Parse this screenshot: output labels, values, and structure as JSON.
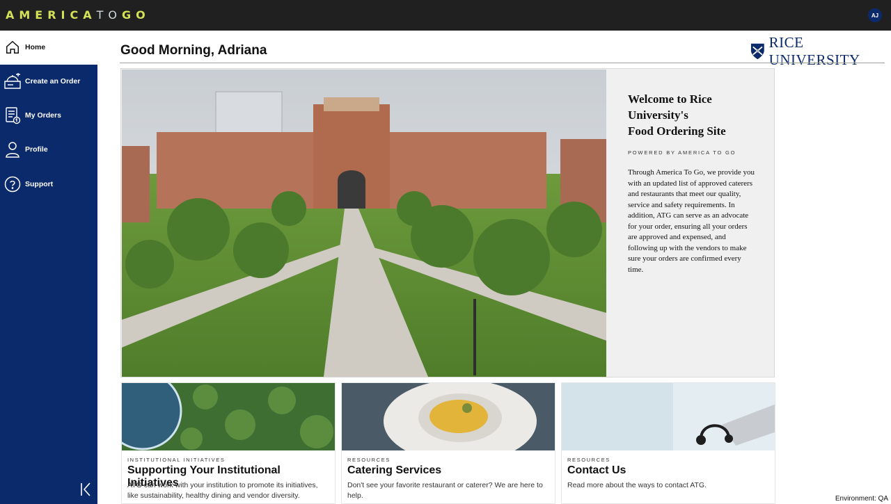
{
  "brand": {
    "part1": "AMERICA",
    "part2": "TO",
    "part3": "GO",
    "accent": "#d4e157"
  },
  "user": {
    "initials": "AJ"
  },
  "nav": {
    "home": "Home",
    "create_order": "Create an Order",
    "my_orders": "My Orders",
    "profile": "Profile",
    "support": "Support"
  },
  "header": {
    "greeting": "Good Morning, Adriana",
    "logo_text": "RICE UNIVERSITY"
  },
  "hero": {
    "title_line1": "Welcome to Rice",
    "title_line2": "University's",
    "title_line3": "Food Ordering Site",
    "powered_by": "POWERED BY AMERICA TO GO",
    "body": "Through America To Go, we provide you with an updated list of approved caterers and restaurants that meet our quality, service and safety requirements. In addition, ATG can serve as an advocate for your order, ensuring all your orders are approved and expensed, and following up with the vendors to make sure your orders are confirmed every time."
  },
  "cards": [
    {
      "category": "INSTITUTIONAL INITIATIVES",
      "title": "Supporting Your Institutional Initiatives",
      "description": "ATG can work with your institution to promote its initiatives, like sustainability, healthy dining and vendor diversity."
    },
    {
      "category": "RESOURCES",
      "title": "Catering Services",
      "description": "Don't see your favorite restaurant or caterer? We are here to help."
    },
    {
      "category": "RESOURCES",
      "title": "Contact Us",
      "description": "Read more about the ways to contact ATG."
    }
  ],
  "footer": {
    "environment": "Environment: QA"
  },
  "colors": {
    "navy": "#0b2a6b",
    "topbar": "#202020"
  }
}
